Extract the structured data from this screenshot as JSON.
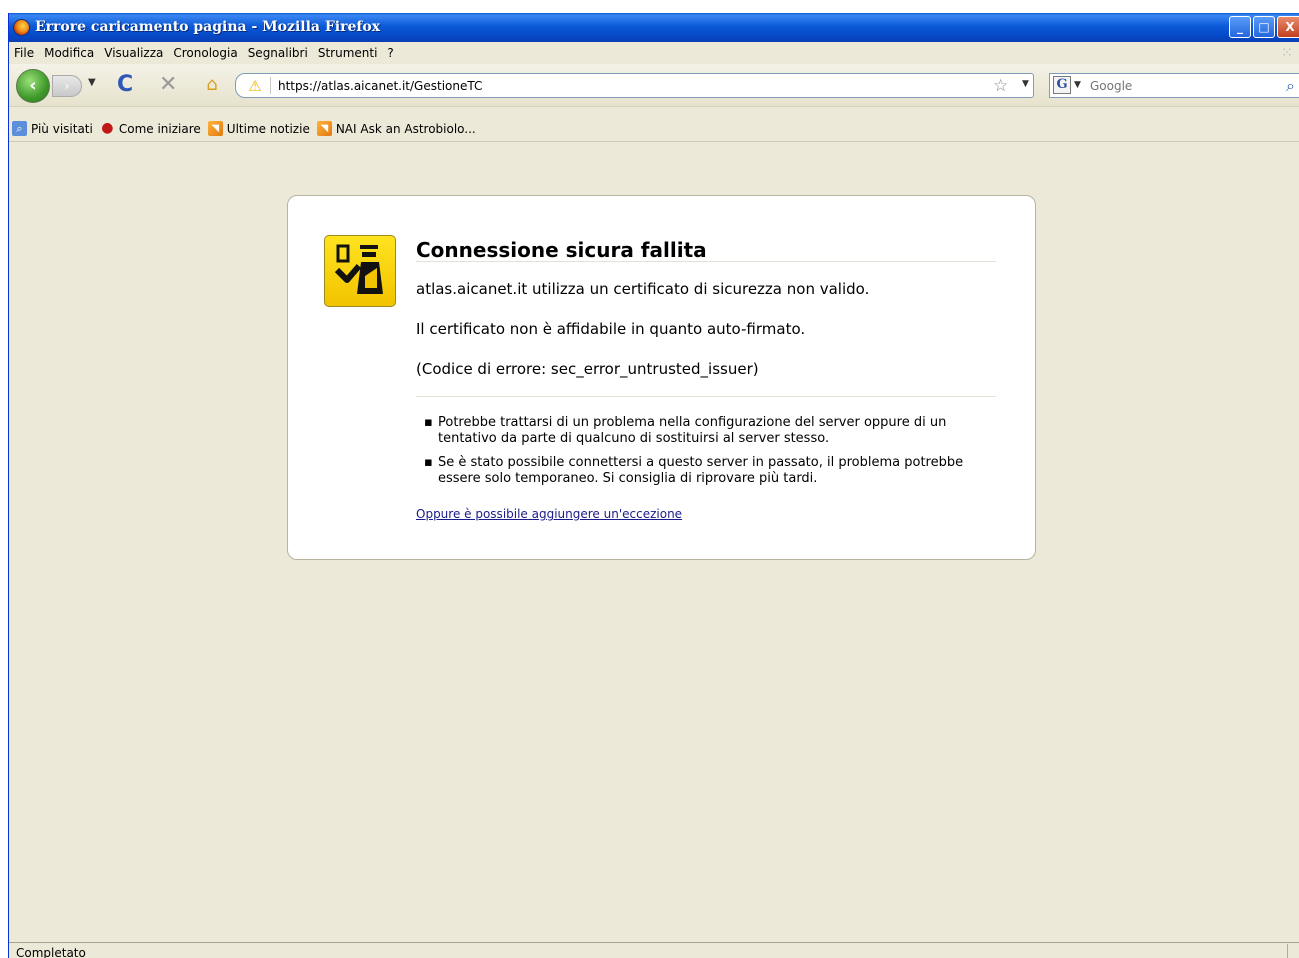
{
  "window": {
    "title": "Errore caricamento pagina - Mozilla Firefox",
    "buttons": {
      "minimize": "_",
      "maximize": "□",
      "close": "X"
    }
  },
  "menubar": {
    "items": [
      {
        "label": "File",
        "accesskey": "F"
      },
      {
        "label": "Modifica",
        "accesskey": "M"
      },
      {
        "label": "Visualizza",
        "accesskey": "V"
      },
      {
        "label": "Cronologia",
        "accesskey": "C"
      },
      {
        "label": "Segnalibri",
        "accesskey": "e"
      },
      {
        "label": "Strumenti",
        "accesskey": "S"
      },
      {
        "label": "?",
        "accesskey": "?"
      }
    ]
  },
  "navbar": {
    "url": "https://atlas.aicanet.it/GestioneTC",
    "search_placeholder": "Google",
    "search_engine_letter": "G"
  },
  "bookmarks": {
    "items": [
      {
        "label": "Più visitati",
        "icon": "search-icon"
      },
      {
        "label": "Come iniziare",
        "icon": "firefox-bookmark-icon"
      },
      {
        "label": "Ultime notizie",
        "icon": "rss-icon"
      },
      {
        "label": "NAI Ask an Astrobiolo...",
        "icon": "rss-icon"
      }
    ]
  },
  "error": {
    "title": "Connessione sicura fallita",
    "paragraphs": [
      "atlas.aicanet.it utilizza un certificato di sicurezza non valido.",
      "Il certificato non è affidabile in quanto auto-firmato.",
      "(Codice di errore: sec_error_untrusted_issuer)"
    ],
    "bullets": [
      "Potrebbe trattarsi di un problema nella configurazione del server oppure di un tentativo da parte di qualcuno di sostituirsi al server stesso.",
      "Se è stato possibile connettersi a questo server in passato, il problema potrebbe essere solo temporaneo. Si consiglia di riprovare più tardi."
    ],
    "exception_link": "Oppure è possibile aggiungere un'eccezione"
  },
  "statusbar": {
    "text": "Completato"
  },
  "colors": {
    "titlebar": "#0b5ad8",
    "chrome": "#ece9d8",
    "error_icon": "#f2c300",
    "link": "#1a1a8a"
  }
}
